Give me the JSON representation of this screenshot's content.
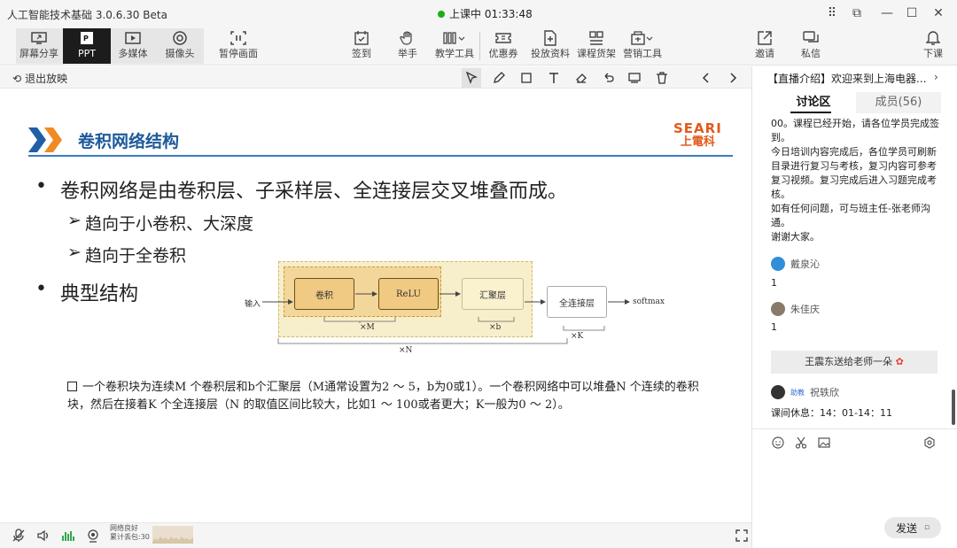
{
  "window": {
    "title": "人工智能技术基础 3.0.6.30 Beta",
    "live_status": "上课中 01:33:48"
  },
  "toolbar": {
    "left": [
      {
        "label": "屏幕分享",
        "icon": "screen-share-icon"
      },
      {
        "label": "PPT",
        "icon": "ppt-icon"
      },
      {
        "label": "多媒体",
        "icon": "multimedia-icon"
      },
      {
        "label": "摄像头",
        "icon": "camera-icon"
      },
      {
        "label": "暂停画面",
        "icon": "pause-screen-icon"
      }
    ],
    "center": [
      {
        "label": "签到",
        "icon": "checkin-icon"
      },
      {
        "label": "举手",
        "icon": "raise-hand-icon"
      },
      {
        "label": "教学工具",
        "icon": "teaching-tools-icon"
      },
      {
        "label": "优惠券",
        "icon": "coupon-icon"
      },
      {
        "label": "投放资料",
        "icon": "deliver-materials-icon"
      },
      {
        "label": "课程货架",
        "icon": "course-shelf-icon"
      },
      {
        "label": "营销工具",
        "icon": "marketing-tools-icon"
      }
    ],
    "right": [
      {
        "label": "邀请",
        "icon": "invite-icon"
      },
      {
        "label": "私信",
        "icon": "private-message-icon"
      },
      {
        "label": "下课",
        "icon": "end-class-icon"
      }
    ]
  },
  "strip": {
    "exit_label": "退出放映"
  },
  "slide": {
    "title": "卷积网络结构",
    "logo_en": "SEARI",
    "logo_zh": "上電科",
    "bullet1": "卷积网络是由卷积层、子采样层、全连接层交叉堆叠而成。",
    "sub1": "趋向于小卷积、大深度",
    "sub2": "趋向于全卷积",
    "bullet2": "典型结构",
    "diagram": {
      "input": "输入",
      "conv": "卷积",
      "relu": "ReLU",
      "pool": "汇聚层",
      "fc": "全连接层",
      "softmax": "softmax",
      "xm": "×M",
      "xb": "×b",
      "xn": "×N",
      "xk": "×K"
    },
    "note": "一个卷积块为连续M 个卷积层和b个汇聚层（M通常设置为2 ～ 5，b为0或1）。一个卷积网络中可以堆叠N 个连续的卷积块，然后在接着K 个全连接层（N 的取值区间比较大，比如1 ～ 100或者更大；K一般为0 ～ 2）。"
  },
  "bottom": {
    "net_status": "网络良好",
    "lost_packets": "累计丢包:30"
  },
  "chat": {
    "notice": "【直播介绍】欢迎来到上海电器...",
    "tab_discuss": "讨论区",
    "tab_members": "成员(56)",
    "message_lines": [
      "00。课程已经开始，请各位学员完成签到。",
      "今日培训内容完成后，各位学员可刷新目录进行复习与考核，复习内容可参考复习视频。复习完成后进入习题完成考核。",
      "如有任何问题，可与班主任-张老师沟通。",
      "谢谢大家。"
    ],
    "user1": "戴泉沁",
    "user1_msg": "1",
    "user2": "朱佳庆",
    "user2_msg": "1",
    "gift": "王震东送给老师一朵",
    "user3_tag": "助教",
    "user3": "祝轶欣",
    "user3_msg": "课间休息：14：01-14：11",
    "send": "发送"
  }
}
